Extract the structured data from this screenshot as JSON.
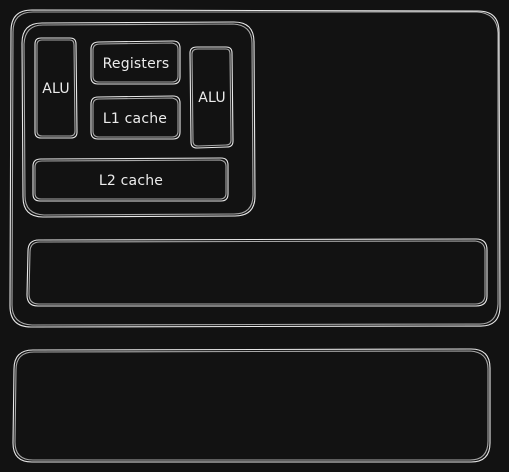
{
  "colors": {
    "background": "#121212",
    "stroke": "#e8e8e8",
    "text": "#ececec"
  },
  "diagram": {
    "alu_left": "ALU",
    "registers": "Registers",
    "l1_cache": "L1 cache",
    "alu_right": "ALU",
    "l2_cache": "L2 cache"
  }
}
